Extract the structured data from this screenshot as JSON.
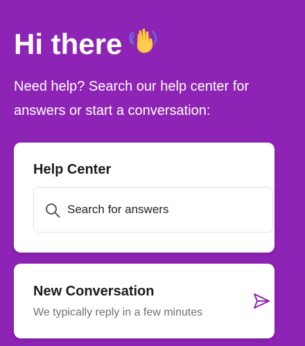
{
  "header": {
    "title": "Hi there",
    "title_emoji": "waving-hand-icon",
    "subtitle": "Need help? Search our help center for answers or start a conversation:"
  },
  "help_center": {
    "title": "Help Center",
    "search": {
      "placeholder": "Search for answers",
      "icon": "search-icon"
    }
  },
  "new_conversation": {
    "title": "New Conversation",
    "subtitle": "We typically reply in a few minutes",
    "icon": "send-icon"
  },
  "colors": {
    "background": "#8e24b5",
    "accent": "#8e24b5",
    "card": "#ffffff"
  }
}
